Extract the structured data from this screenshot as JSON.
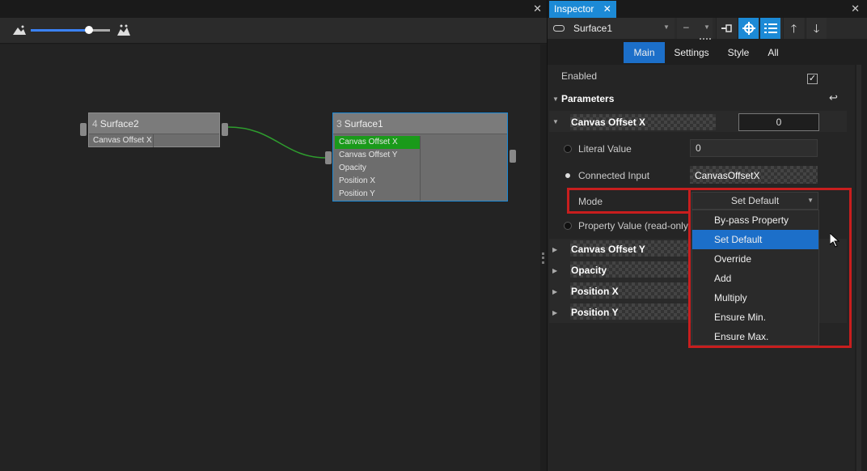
{
  "graph": {
    "nodes": [
      {
        "index": "4",
        "title": "Surface2",
        "params": [
          "Canvas Offset X"
        ]
      },
      {
        "index": "3",
        "title": "Surface1",
        "params": [
          "Canvas Offset X",
          "Canvas Offset Y",
          "Opacity",
          "Position X",
          "Position Y"
        ]
      }
    ]
  },
  "inspector": {
    "tab_label": "Inspector",
    "close_glyph": "✕",
    "object_name": "Surface1",
    "dash_value": "–",
    "subtabs": [
      "Main",
      "Settings",
      "Style",
      "All"
    ],
    "active_subtab": "Main",
    "enabled_label": "Enabled",
    "enabled_check": "✓",
    "parameters_label": "Parameters",
    "param_expanded": {
      "name": "Canvas Offset X",
      "value": "0",
      "literal_label": "Literal Value",
      "literal_value": "0",
      "connected_label": "Connected Input",
      "connected_value": "CanvasOffsetX",
      "mode_label": "Mode",
      "mode_value": "Set Default",
      "property_value_label": "Property Value (read-only)"
    },
    "params_collapsed": [
      "Canvas Offset Y",
      "Opacity",
      "Position X",
      "Position Y"
    ],
    "mode_options": [
      "By-pass Property",
      "Set Default",
      "Override",
      "Add",
      "Multiply",
      "Ensure Min.",
      "Ensure Max."
    ],
    "mode_selected": "Set Default"
  },
  "left_close_glyph": "✕",
  "colors": {
    "accent": "#1c8ad6",
    "selection": "#1c6fc9",
    "highlight": "#c81e1e",
    "connection": "#2e9d2e"
  }
}
